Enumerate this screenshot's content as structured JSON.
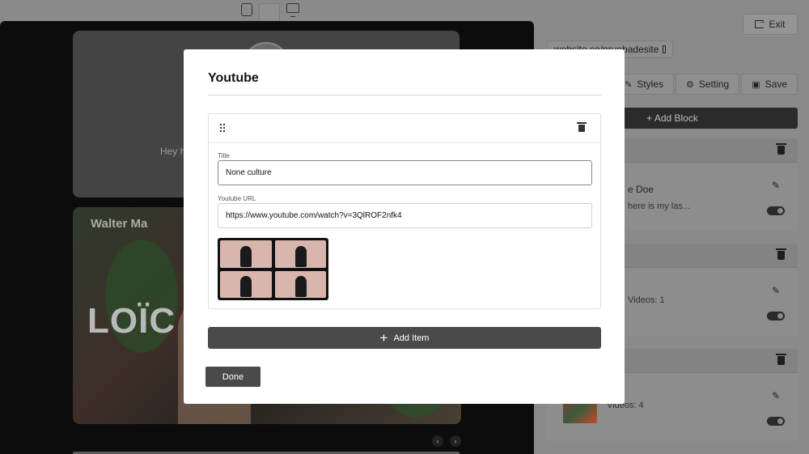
{
  "preview": {
    "bio_text": "Hey h",
    "hero_name_small": "Walter Ma",
    "hero_name_big": "LOÏC",
    "pager_prev": "‹",
    "pager_next": "›"
  },
  "panel": {
    "exit_label": "Exit",
    "site_url": "website.co/pruebadesite",
    "tabs": [
      {
        "label": "Styles",
        "icon": "brush-icon"
      },
      {
        "label": "Setting",
        "icon": "gear-icon"
      },
      {
        "label": "Save",
        "icon": "save-icon"
      }
    ],
    "add_block_label": "+ Add Block",
    "blocks": [
      {
        "title": "e Doe",
        "subtitle": "here is my las..."
      },
      {
        "title": "",
        "subtitle": "Videos: 1"
      },
      {
        "title": "",
        "subtitle": "Videos: 4"
      }
    ]
  },
  "modal": {
    "title": "Youtube",
    "item": {
      "title_label": "Title",
      "title_value": "None culture",
      "url_label": "Youtube URL",
      "url_value": "https://www.youtube.com/watch?v=3QlROF2nfk4"
    },
    "add_item_label": "Add Item",
    "done_label": "Done"
  }
}
